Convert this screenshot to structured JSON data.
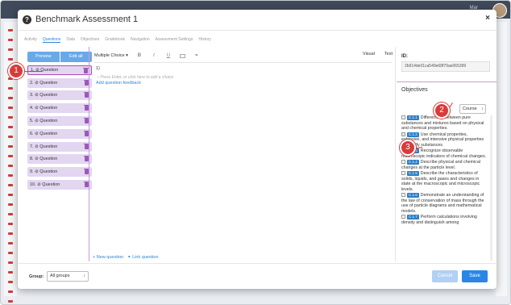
{
  "background": {
    "user_text": "Mar"
  },
  "modal": {
    "title": "Benchmark Assessment 1",
    "close_label": "×",
    "help_label": "?",
    "tabs": [
      {
        "label": "Activity"
      },
      {
        "label": "Questions"
      },
      {
        "label": "Data"
      },
      {
        "label": "Objectives"
      },
      {
        "label": "Gradebook"
      },
      {
        "label": "Navigation"
      },
      {
        "label": "Assessment Settings"
      },
      {
        "label": "History"
      }
    ],
    "active_tab": "Questions"
  },
  "questions": {
    "preview_label": "Preview",
    "edit_all_label": "Edit all",
    "items": [
      {
        "label": "1. ⊘ Question"
      },
      {
        "label": "2. ⊘ Question"
      },
      {
        "label": "3. ⊘ Question"
      },
      {
        "label": "4. ⊘ Question"
      },
      {
        "label": "5. ⊘ Question"
      },
      {
        "label": "6. ⊘ Question"
      },
      {
        "label": "7. ⊘ Question"
      },
      {
        "label": "8. ⊘ Question"
      },
      {
        "label": "9. ⊘ Question"
      },
      {
        "label": "10. ⊘ Question"
      }
    ],
    "new_question_label": "+ New question",
    "link_question_label": "⚭ Link question"
  },
  "editor": {
    "question_type": "Multiple Choice ▾",
    "bold": "B",
    "italic": "I",
    "underline": "U",
    "visual_tab": "Visual",
    "text_tab": "Text",
    "question_number": "1)",
    "choice_placeholder": "○  Press Enter, or click here to add a choice",
    "add_feedback_label": "Add question feedback"
  },
  "right_panel": {
    "id_label": "ID:",
    "id_value": "2b914de01ca549e68f79ae065399",
    "objectives_title": "Objectives",
    "course_select": "Course",
    "objectives": [
      {
        "code": "C.1.1",
        "text": "Differentiate between pure substances and mixtures based on physical and chemical properties.",
        "checked": false
      },
      {
        "code": "C.1.2",
        "text": "Use chemical properties, extensive, and intensive physical properties to identify substances.",
        "checked": true
      },
      {
        "code": "C.1.3",
        "text": "Recognize observable macroscopic indicators of chemical changes.",
        "checked": true
      },
      {
        "code": "C.1.4",
        "text": "Describe physical and chemical changes at the particle level.",
        "checked": false
      },
      {
        "code": "C.1.5",
        "text": "Describe the characteristics of solids, liquids, and gases and changes in state at the macroscopic and microscopic levels.",
        "checked": false
      },
      {
        "code": "C.1.6",
        "text": "Demonstrate an understanding of the law of conservation of mass through the use of particle diagrams and mathematical models.",
        "checked": false
      },
      {
        "code": "C.1.7",
        "text": "Perform calculations involving density and distinguish among",
        "checked": false
      }
    ]
  },
  "footer": {
    "group_label": "Group:",
    "group_value": "All groups",
    "cancel_label": "Cancel",
    "save_label": "Save"
  },
  "callouts": [
    "1",
    "2",
    "3"
  ],
  "colors": {
    "accent": "#2a86d9",
    "question_bg": "#e2d6f1",
    "callout": "#d93b3b",
    "objective_code": "#2a7fc7"
  }
}
